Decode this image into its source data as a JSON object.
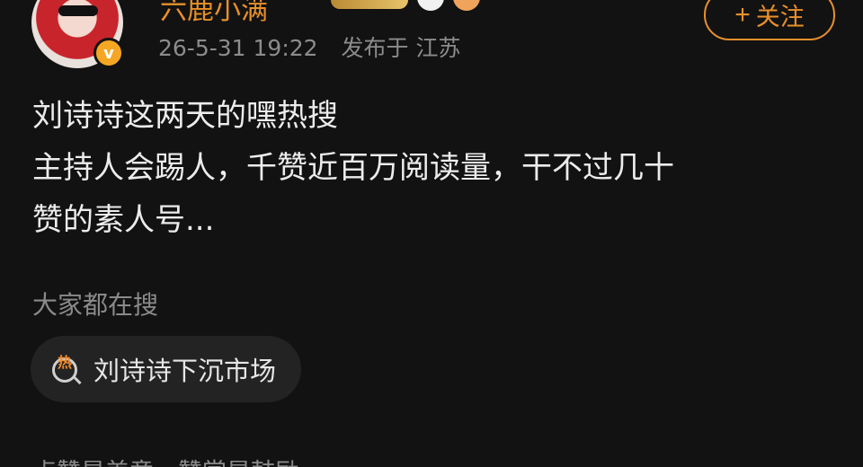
{
  "header": {
    "username": "六鹿小满",
    "post_time": "26-5-31 19:22",
    "location": "发布于 江苏",
    "follow_label": "关注",
    "follow_icon": "+"
  },
  "post": {
    "lines": [
      "刘诗诗这两天的嘿热搜",
      "主持人会踢人，千赞近百万阅读量，干不过几十",
      "赞的素人号..."
    ]
  },
  "related": {
    "label": "大家都在搜",
    "chip": {
      "hot_mark": "热",
      "text": "刘诗诗下沉市场"
    }
  },
  "footer": {
    "text": "点赞是美意，赞赏是鼓励"
  },
  "colors": {
    "background": "#121212",
    "accent": "#e8902a",
    "muted": "#8a8a8a",
    "chip_bg": "#232323"
  },
  "icons": [
    "avatar",
    "verified-badge-icon",
    "level-badge-icon",
    "panda-badge-icon",
    "fan-badge-icon",
    "plus-icon",
    "hot-search-icon"
  ]
}
